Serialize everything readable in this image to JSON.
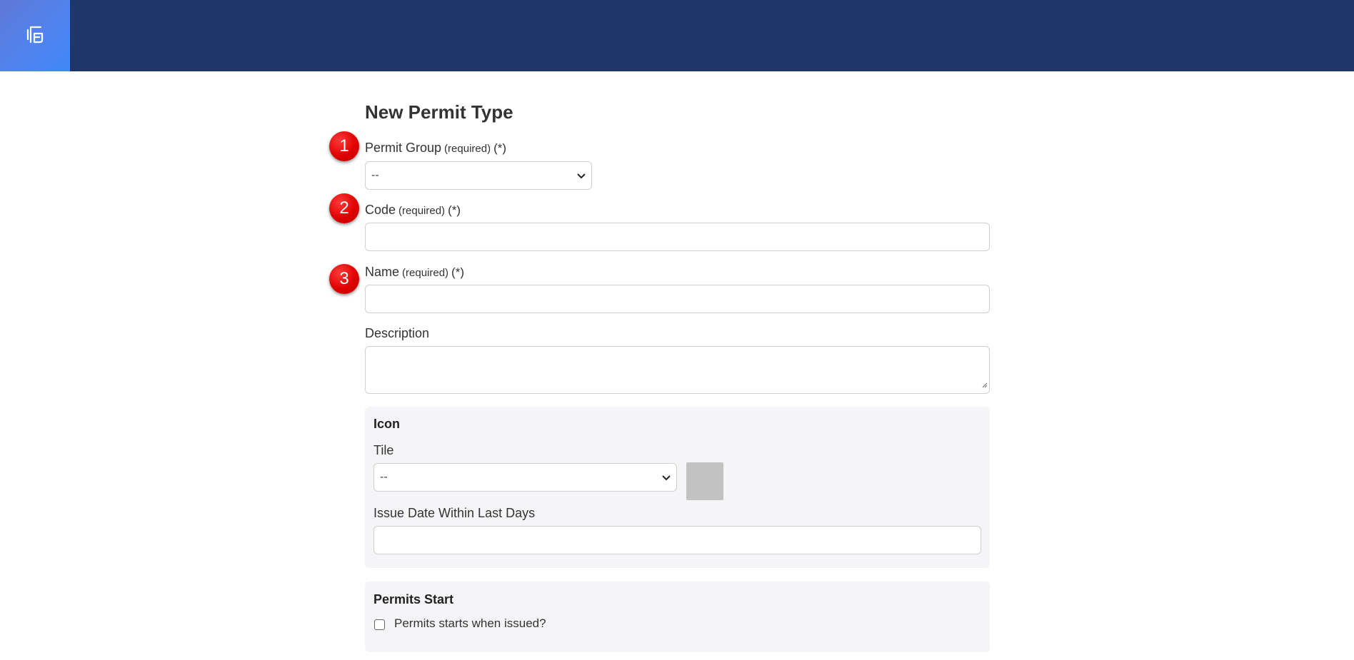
{
  "header": {
    "logo_icon": "file-document-icon"
  },
  "form": {
    "title": "New Permit Type",
    "permit_group": {
      "label": "Permit Group",
      "required": "(required)",
      "asterisk": "(*)",
      "value": "--"
    },
    "code": {
      "label": "Code",
      "required": "(required)",
      "asterisk": "(*)",
      "value": ""
    },
    "name": {
      "label": "Name",
      "required": "(required)",
      "asterisk": "(*)",
      "value": ""
    },
    "description": {
      "label": "Description",
      "value": ""
    },
    "icon_section": {
      "title": "Icon",
      "tile_label": "Tile",
      "tile_value": "--",
      "issue_date_label": "Issue Date Within Last Days",
      "issue_date_value": ""
    },
    "permits_start": {
      "title": "Permits Start",
      "checkbox_label": "Permits starts when issued?",
      "checked": false
    }
  },
  "annotations": [
    "1",
    "2",
    "3"
  ],
  "colors": {
    "header": "#1e3669",
    "logo_tile": "#4f84f0",
    "badge": "#e00000",
    "panel": "#f5f5f7"
  }
}
